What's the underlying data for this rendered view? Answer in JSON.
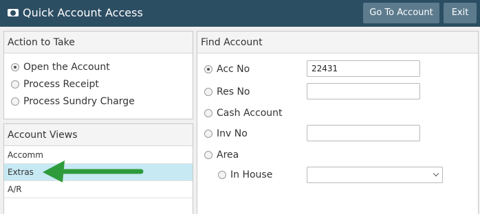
{
  "header": {
    "title": "Quick Account Access",
    "title_icon": "money-icon",
    "go_button": "Go To Account",
    "exit_button": "Exit"
  },
  "action": {
    "heading": "Action to Take",
    "options": [
      "Open the Account",
      "Process Receipt",
      "Process Sundry Charge"
    ],
    "selected": "Open the Account"
  },
  "views": {
    "heading": "Account Views",
    "items": [
      "Accomm",
      "Extras",
      "A/R"
    ],
    "selected": "Extras"
  },
  "find": {
    "heading": "Find Account",
    "acc_no_label": "Acc No",
    "acc_no_value": "22431",
    "res_no_label": "Res No",
    "res_no_value": "",
    "cash_label": "Cash Account",
    "inv_no_label": "Inv No",
    "inv_no_value": "",
    "area_label": "Area",
    "in_house_label": "In House",
    "in_house_value": "",
    "selected": "Acc No"
  },
  "annotation": {
    "arrow_color": "#2e9b3a"
  }
}
